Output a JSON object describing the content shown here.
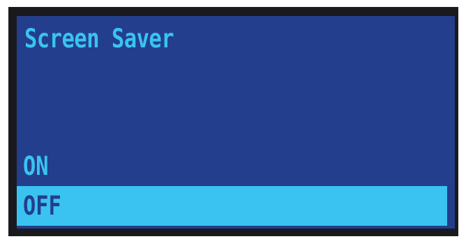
{
  "menu": {
    "title": "Screen Saver",
    "options": [
      {
        "label": "ON",
        "selected": false
      },
      {
        "label": "OFF",
        "selected": true
      }
    ]
  },
  "colors": {
    "bezel": "#1a1a1e",
    "screen_background": "#233e8c",
    "accent": "#3ac3f0"
  }
}
